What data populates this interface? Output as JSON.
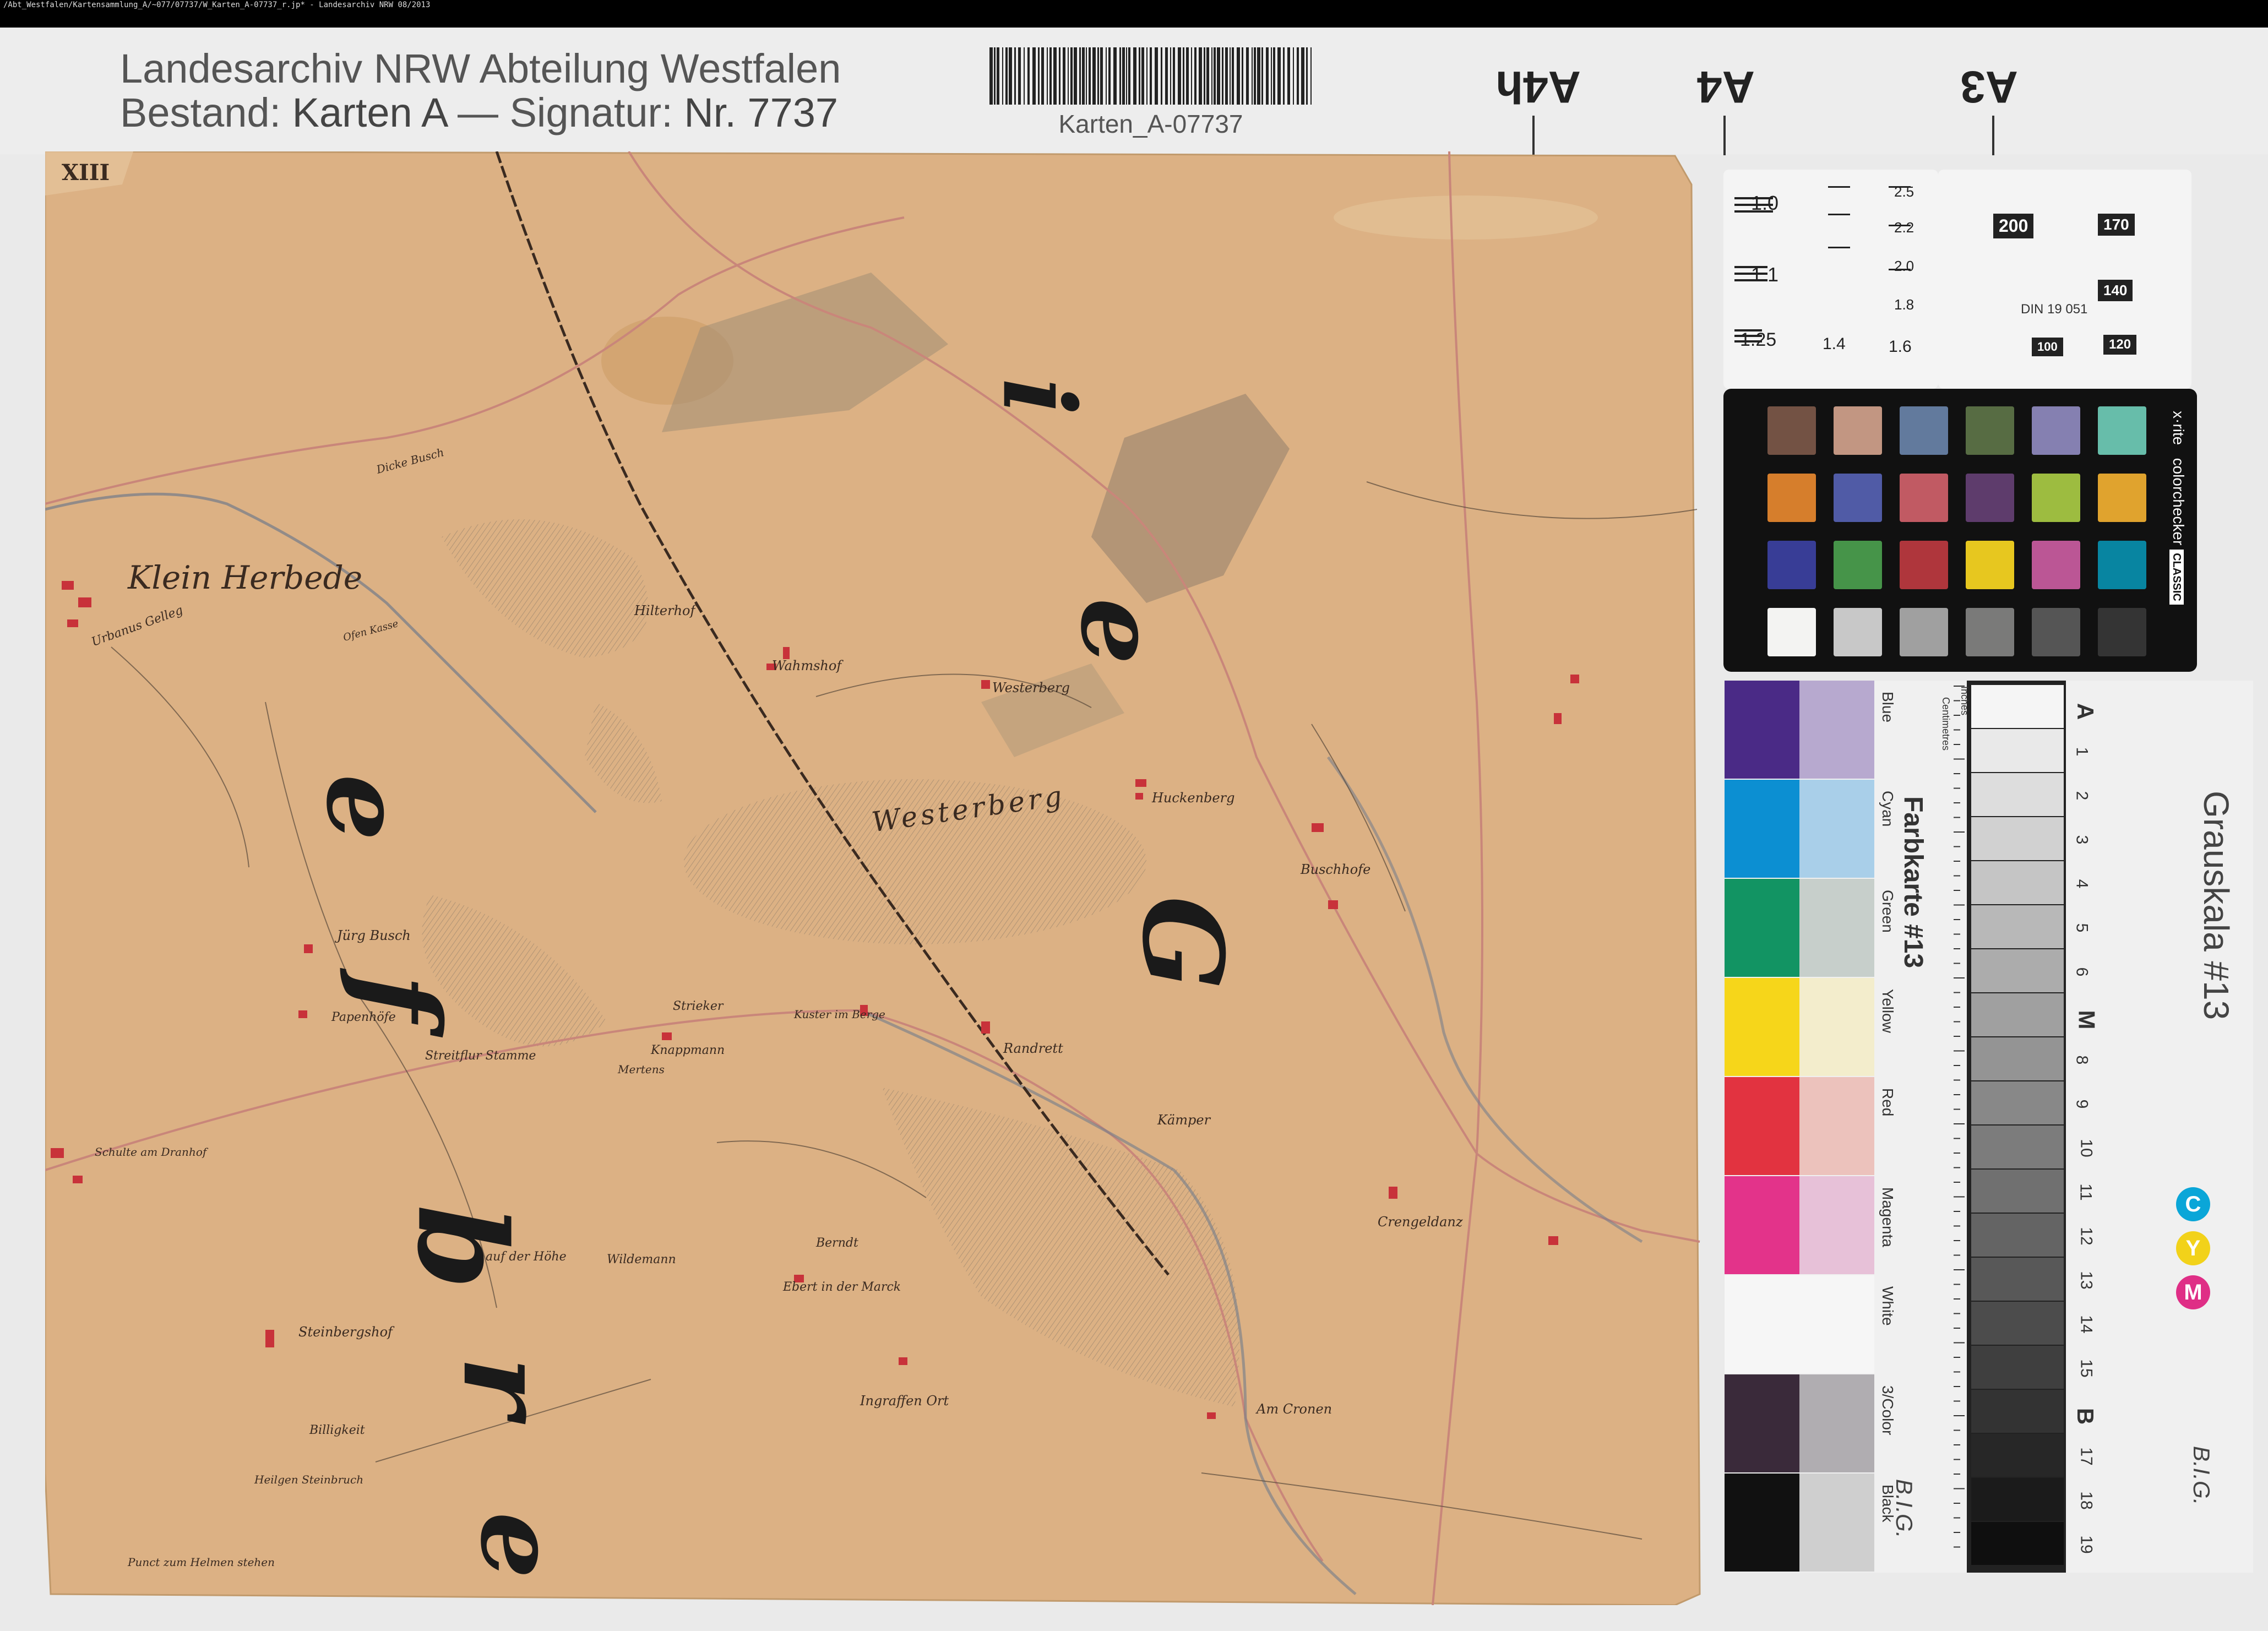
{
  "top_bar": {
    "path": "/Abt_Westfalen/Kartensammlung_A/~077/07737/W_Karten_A-07737_r.jp* - Landesarchiv NRW 08/2013"
  },
  "header": {
    "institution": "Landesarchiv NRW Abteilung Westfalen",
    "bestand_label": "Bestand:",
    "bestand_value": "Karten A",
    "separator": "—",
    "signatur_label": "Signatur:",
    "signatur_value": "Nr. 7737",
    "barcode_text": "Karten_A-07737"
  },
  "format_marks": [
    "A4h",
    "A4",
    "A3"
  ],
  "map": {
    "sheet_number": "XIII",
    "town": "Klein Herbede",
    "hill": "Westerberg",
    "big_letters": [
      "i",
      "e",
      "G",
      "e",
      "f",
      "b",
      "r",
      "e"
    ],
    "places": [
      "Hilterhof",
      "Wahmshof",
      "Westerberg",
      "Huckenberg",
      "Buschhofe",
      "Jürg Busch",
      "Papenhöfe",
      "Streitflur Stamme",
      "Knappmann",
      "Mertens",
      "Strieker",
      "Kuster im Berge",
      "Randrett",
      "Kämper",
      "Crengeldanz",
      "Schulte am Dranhof",
      "auf der Höhe",
      "Wildemann",
      "Berndt",
      "Ebert in der Marck",
      "Steinbergshof",
      "Billigkeit",
      "Ingraffen Ort",
      "Am Cronen",
      "Heilgen Steinbruch",
      "Punct zum Helmen stehen",
      "Urbanus Gelleg",
      "Dicke Busch",
      "Ofen Kasse"
    ]
  },
  "gray_scale": {
    "title": "Grauskala #13",
    "patches": [
      "A",
      "1",
      "2",
      "3",
      "4",
      "5",
      "6",
      "M",
      "8",
      "9",
      "10",
      "11",
      "12",
      "13",
      "14",
      "15",
      "B",
      "17",
      "18",
      "19"
    ],
    "brand": "B.I.G."
  },
  "color_card": {
    "title": "Farbkarte #13",
    "rows": [
      "Blue",
      "Cyan",
      "Green",
      "Yellow",
      "Red",
      "Magenta",
      "White",
      "3/Color",
      "Black"
    ],
    "brand": "B.I.G.",
    "ruler_inches": "Inches",
    "ruler_cm": "Centimetres",
    "cmy": [
      "C",
      "Y",
      "M"
    ]
  },
  "colorchecker": {
    "brand": "x·rite",
    "name": "colorchecker",
    "variant": "CLASSIC",
    "colors": [
      "#735244",
      "#c29682",
      "#627a9d",
      "#576c43",
      "#8580b1",
      "#67bdaa",
      "#d67e2c",
      "#505ba6",
      "#c15a63",
      "#5e3c6c",
      "#9dbc40",
      "#e0a32e",
      "#383d96",
      "#469449",
      "#af363c",
      "#e7c71f",
      "#bb5695",
      "#0885a1",
      "#f3f3f2",
      "#c8c8c8",
      "#a0a0a0",
      "#7a7a79",
      "#555555",
      "#343434"
    ]
  },
  "resolution_target": {
    "left_values": [
      "1.0",
      "1.1",
      "1.25",
      "1.4",
      "1.6",
      "1.8",
      "2.0",
      "2.2",
      "2.5"
    ],
    "right_values": [
      "200",
      "170",
      "140",
      "120",
      "100",
      "DIN 19 051"
    ]
  },
  "colors": {
    "paper": "#dcb184",
    "road": "#c9867a",
    "hatch": "#8a7a68",
    "ink": "#2b2020"
  }
}
